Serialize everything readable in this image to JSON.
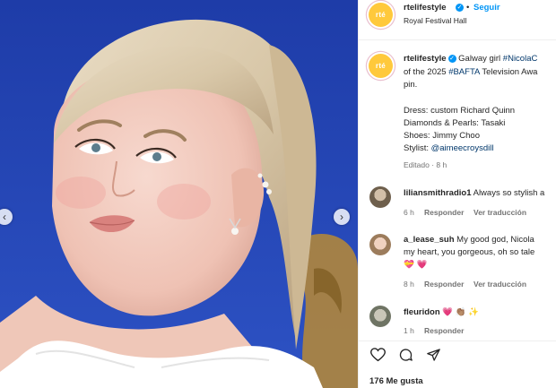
{
  "post": {
    "account": "rtelifestyle",
    "avatar_text": "rté",
    "dot": "•",
    "follow_label": "Seguir",
    "location": "Royal Festival Hall"
  },
  "caption": {
    "user": "rtelifestyle",
    "line1_pre": " Galway girl ",
    "line1_tag": "#NicolaC",
    "line2_pre": "of the 2025 ",
    "line2_tag": "#BAFTA",
    "line2_post": " Television Awa",
    "line3": "pin.",
    "credit1": "Dress: custom Richard Quinn",
    "credit2": "Diamonds & Pearls: Tasaki",
    "credit3": "Shoes: Jimmy Choo",
    "credit4_pre": "Stylist: ",
    "credit4_link": "@aimeecroysdill",
    "meta": "Editado · 8 h"
  },
  "comments": [
    {
      "user": "liliansmithradio1",
      "text_line1": " Always so stylish a",
      "text_line2": "",
      "time": "6 h",
      "reply": "Responder",
      "translate": "Ver traducción"
    },
    {
      "user": "a_lease_suh",
      "text_line1": " My good god, Nicola",
      "text_line2": "my heart, you gorgeous, oh so tale",
      "emoji": "💝 💗",
      "time": "8 h",
      "reply": "Responder",
      "translate": "Ver traducción"
    },
    {
      "user": "fleuridon",
      "text_line1": " 💗 👏🏽 ✨",
      "time": "1 h",
      "reply": "Responder"
    }
  ],
  "likes": "176 Me gusta",
  "icons": {
    "prev": "chevron-left-icon",
    "next": "chevron-right-icon",
    "like": "heart-icon",
    "comment": "comment-icon",
    "share": "send-icon",
    "verified": "verified-badge-icon"
  },
  "colors": {
    "accent": "#0095f6",
    "link": "#00376b",
    "avatar": "#ffc93c",
    "backdrop": "#2a50c8"
  }
}
